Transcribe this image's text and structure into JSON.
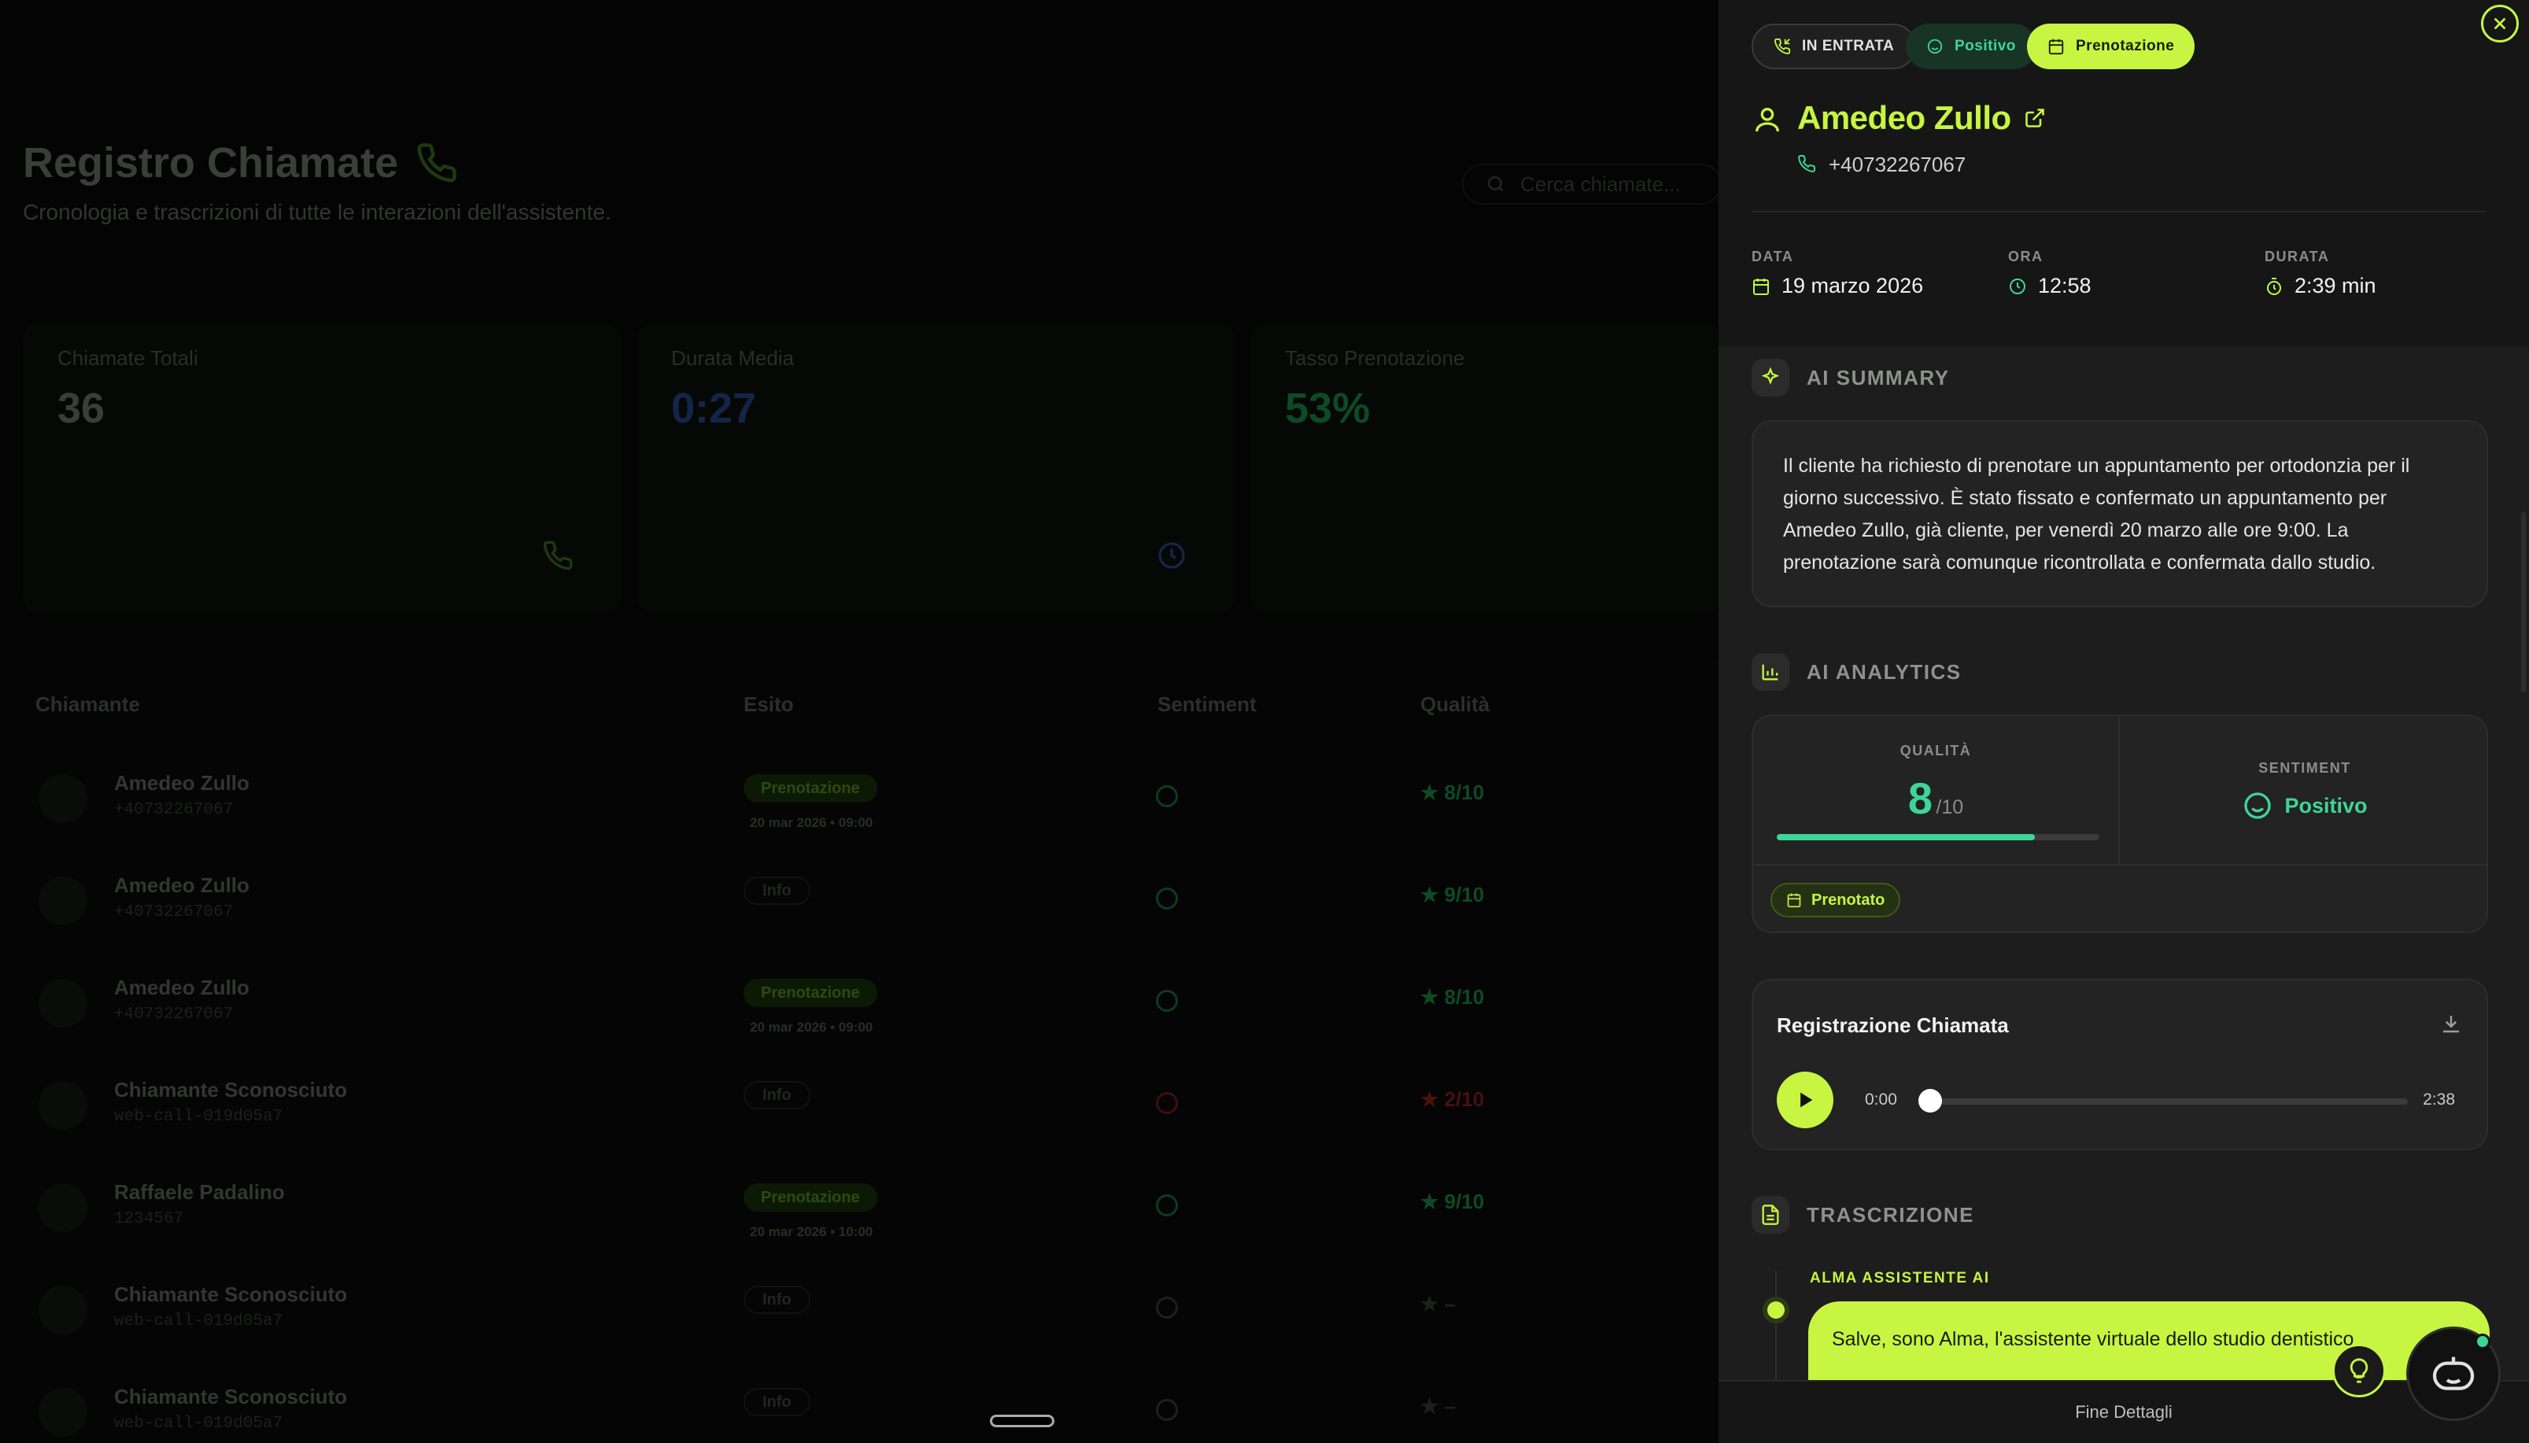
{
  "background": {
    "title": "Registro Chiamate",
    "subtitle": "Cronologia e trascrizioni di tutte le interazioni dell'assistente.",
    "search_placeholder": "Cerca chiamate...",
    "stats": [
      {
        "label": "Chiamate Totali",
        "value": "36",
        "color": "#3a3d3a"
      },
      {
        "label": "Durata Media",
        "value": "0:27",
        "color": "#15254a"
      },
      {
        "label": "Tasso Prenotazione",
        "value": "53%",
        "color": "#0d4a25"
      }
    ],
    "table": {
      "headers": [
        "Chiamante",
        "Esito",
        "Sentiment",
        "Qualità"
      ],
      "rows": [
        {
          "name": "Amedeo Zullo",
          "phone": "+40732267067",
          "outcome": "Prenotazione",
          "date": "20 mar 2026 • 09:00",
          "quality": "8/10",
          "tone": "pos"
        },
        {
          "name": "Amedeo Zullo",
          "phone": "+40732267067",
          "outcome": "Info",
          "date": "",
          "quality": "9/10",
          "tone": "pos"
        },
        {
          "name": "Amedeo Zullo",
          "phone": "+40732267067",
          "outcome": "Prenotazione",
          "date": "20 mar 2026 • 09:00",
          "quality": "8/10",
          "tone": "pos"
        },
        {
          "name": "Chiamante Sconosciuto",
          "phone": "web-call-019d05a7",
          "outcome": "Info",
          "date": "",
          "quality": "2/10",
          "tone": "neg"
        },
        {
          "name": "Raffaele Padalino",
          "phone": "1234567",
          "outcome": "Prenotazione",
          "date": "20 mar 2026 • 10:00",
          "quality": "9/10",
          "tone": "pos"
        },
        {
          "name": "Chiamante Sconosciuto",
          "phone": "web-call-019d05a7",
          "outcome": "Info",
          "date": "",
          "quality": "–",
          "tone": "neu"
        },
        {
          "name": "Chiamante Sconosciuto",
          "phone": "web-call-019d05a7",
          "outcome": "Info",
          "date": "",
          "quality": "–",
          "tone": "neu"
        }
      ]
    }
  },
  "panel": {
    "chips": {
      "direction": "IN ENTRATA",
      "sentiment": "Positivo",
      "outcome": "Prenotazione"
    },
    "contact_name": "Amedeo Zullo",
    "contact_phone": "+40732267067",
    "meta": {
      "date_label": "DATA",
      "date_value": "19 marzo 2026",
      "time_label": "ORA",
      "time_value": "12:58",
      "duration_label": "DURATA",
      "duration_value": "2:39 min"
    },
    "summary_title": "AI SUMMARY",
    "summary_text": "Il cliente ha richiesto di prenotare un appuntamento per ortodonzia per il giorno successivo. È stato fissato e confermato un appuntamento per Amedeo Zullo, già cliente, per venerdì 20 marzo alle ore 9:00. La prenotazione sarà comunque ricontrollata e confermata dallo studio.",
    "analytics_title": "AI ANALYTICS",
    "analytics": {
      "quality_label": "QUALITÀ",
      "quality_value": "8",
      "quality_max": "/10",
      "quality_fraction": 0.8,
      "sentiment_label": "SENTIMENT",
      "sentiment_value": "Positivo",
      "tag": "Prenotato"
    },
    "recording": {
      "title": "Registrazione Chiamata",
      "current_time": "0:00",
      "total_time": "2:38",
      "progress": 0
    },
    "transcript_title": "TRASCRIZIONE",
    "transcript": [
      {
        "speaker": "ALMA ASSISTENTE AI",
        "text": "Salve, sono Alma, l'assistente virtuale dello studio dentistico"
      }
    ],
    "footer": "Fine Dettagli"
  },
  "colors": {
    "accent": "#c7f542",
    "positive": "#3fd49a",
    "panel_bg": "#1c1d1c"
  }
}
